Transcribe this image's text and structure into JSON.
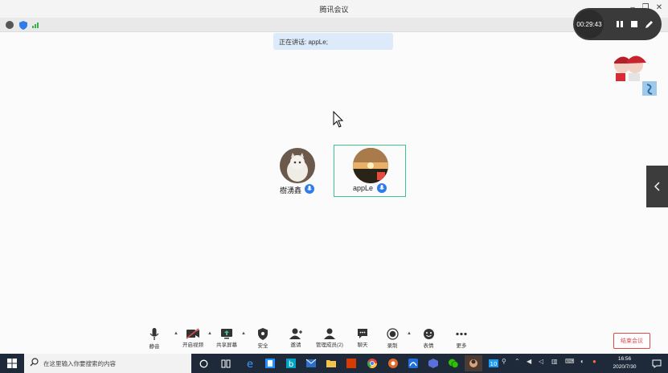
{
  "window": {
    "title": "腾讯会议"
  },
  "recording": {
    "time": "00:29:43"
  },
  "speaking": {
    "text": "正在讲话: appLe;"
  },
  "participants": [
    {
      "name": "樹湧鑫"
    },
    {
      "name": "appLe"
    }
  ],
  "toolbar": {
    "mute": "静音",
    "video": "开启视频",
    "share": "共享屏幕",
    "security": "安全",
    "invite": "邀请",
    "manage": "管理成员(2)",
    "chat": "聊天",
    "record": "录制",
    "emoji": "表情",
    "more": "更多",
    "end": "结束会议"
  },
  "taskbar": {
    "search_placeholder": "在这里输入你要搜索的内容",
    "time": "16:56",
    "date": "2020/7/30"
  },
  "colors": {
    "accent": "#2e7bea",
    "active_border": "#3cc48a",
    "end": "#e24a4a"
  }
}
